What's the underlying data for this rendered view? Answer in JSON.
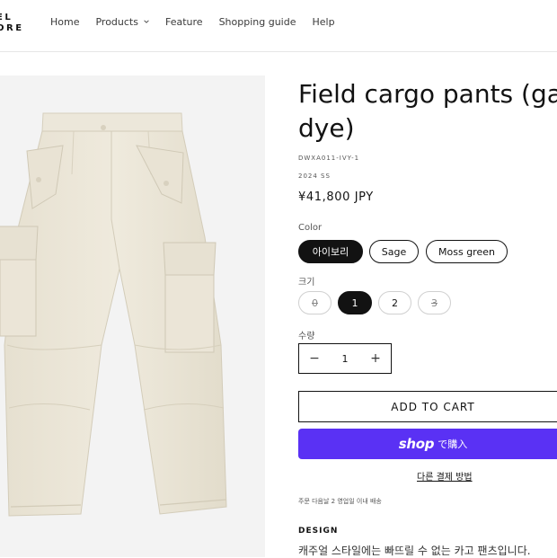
{
  "header": {
    "logo_line1": "EL",
    "logo_line2": "ORE",
    "nav": [
      {
        "label": "Home"
      },
      {
        "label": "Products"
      },
      {
        "label": "Feature"
      },
      {
        "label": "Shopping guide"
      },
      {
        "label": "Help"
      }
    ]
  },
  "product": {
    "title_line1": "Field cargo pants (gar",
    "title_line2": "dye)",
    "sku": "DWXA011-IVY-1",
    "season": "2024 SS",
    "price": "¥41,800 JPY",
    "color_label": "Color",
    "colors": [
      {
        "label": "아이보리",
        "selected": true
      },
      {
        "label": "Sage",
        "selected": false
      },
      {
        "label": "Moss green",
        "selected": false
      }
    ],
    "size_label": "크기",
    "sizes": [
      {
        "label": "0",
        "available": false
      },
      {
        "label": "1",
        "selected": true
      },
      {
        "label": "2"
      },
      {
        "label": "3",
        "available": false
      }
    ],
    "quantity_label": "수량",
    "quantity": "1",
    "qty_minus": "−",
    "qty_plus": "+",
    "add_to_cart": "ADD TO CART",
    "shop_pay_word": "shop",
    "shop_pay_suffix": "で購入",
    "other_payment": "다른 결제 방법",
    "shipping_note": "주문 다음날 2 영업일 이내 배송",
    "design_heading": "DESIGN",
    "description": "캐주얼 스타일에는 빠뜨릴 수 없는 카고 팬츠입니다."
  },
  "colors": {
    "shop_pay": "#5a31f4",
    "pants": "#ebe6d8",
    "image_bg": "#f3f3f3"
  }
}
